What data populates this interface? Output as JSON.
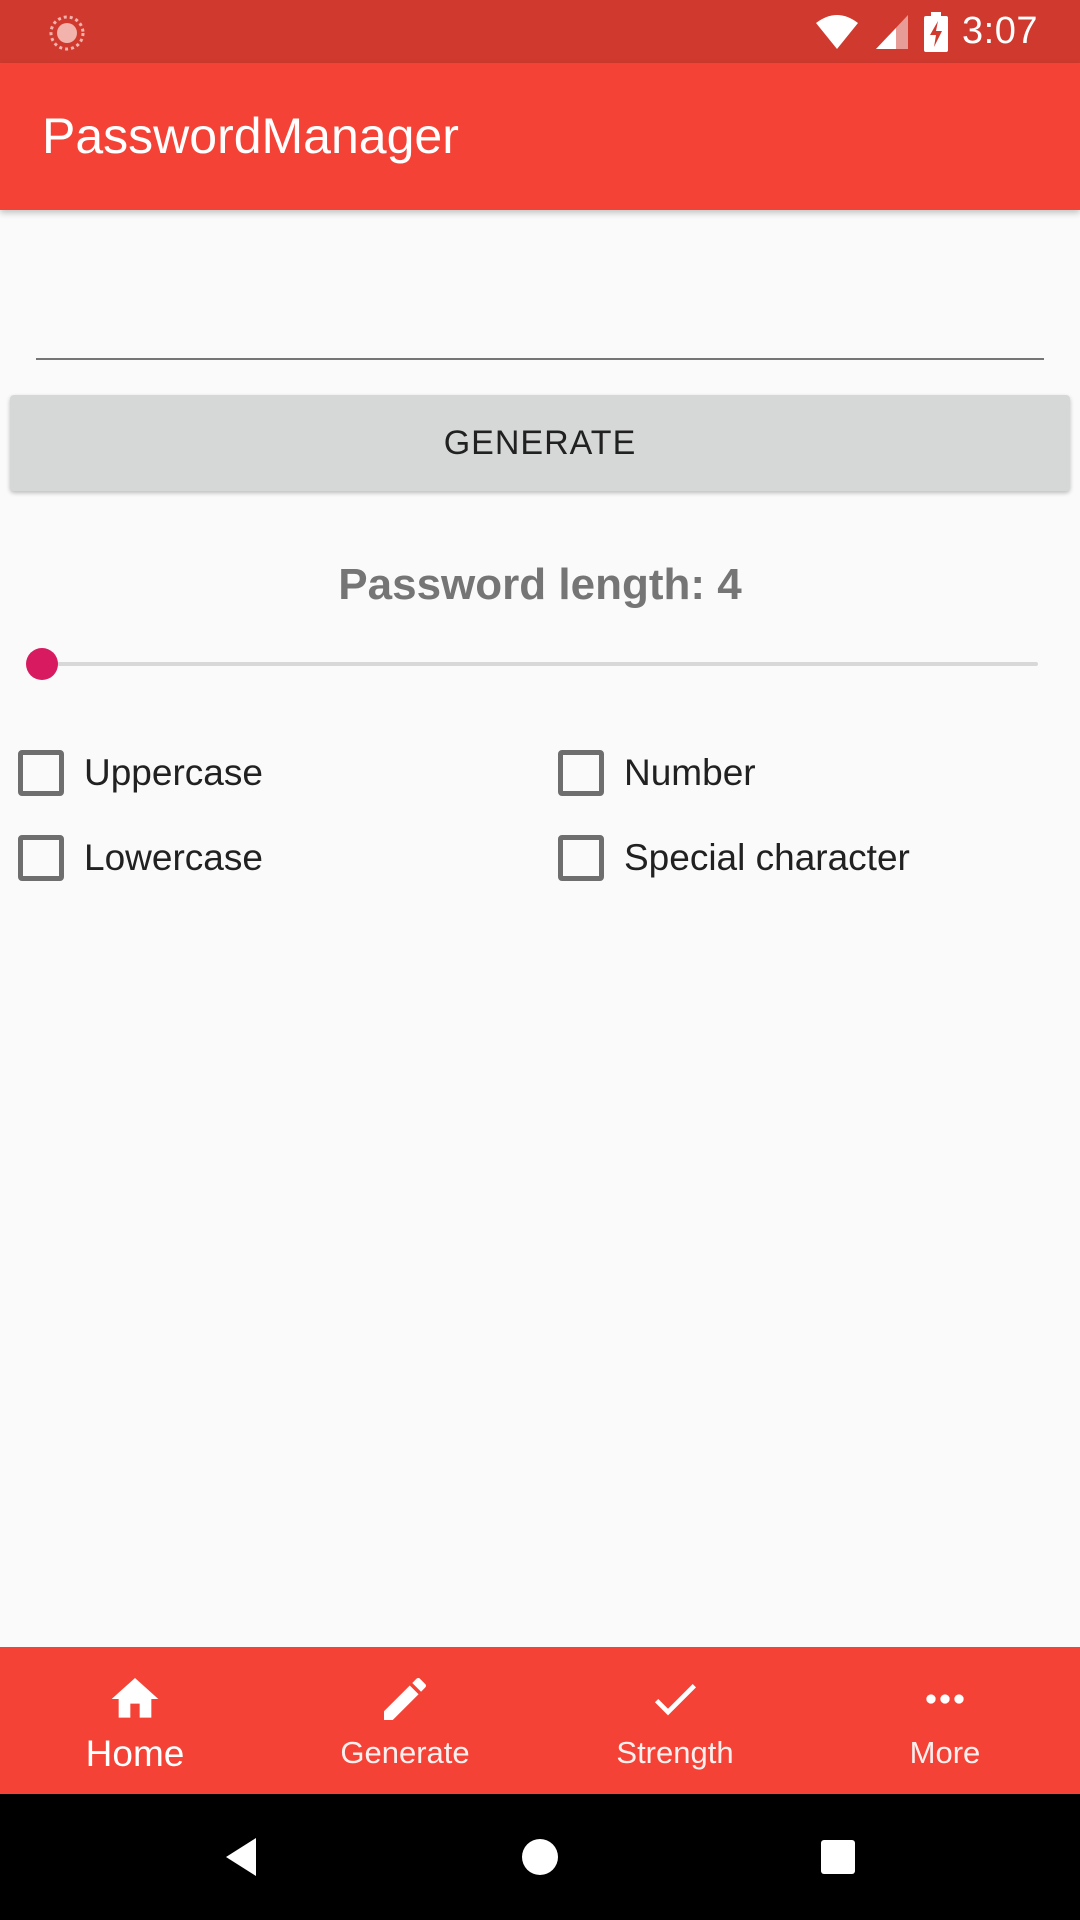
{
  "status_bar": {
    "time": "3:07",
    "icons": [
      "loading-indicator-icon",
      "wifi-icon",
      "cellular-signal-icon",
      "battery-charging-icon"
    ]
  },
  "app_bar": {
    "title": "PasswordManager"
  },
  "password_field": {
    "value": "",
    "placeholder": ""
  },
  "generate_button": {
    "label": "GENERATE"
  },
  "length": {
    "label": "Password length: 4",
    "value": 4,
    "slider_fraction": 0.0
  },
  "options": [
    {
      "label": "Uppercase",
      "checked": false
    },
    {
      "label": "Number",
      "checked": false
    },
    {
      "label": "Lowercase",
      "checked": false
    },
    {
      "label": "Special character",
      "checked": false
    }
  ],
  "bottom_nav": [
    {
      "label": "Home",
      "icon": "home-icon",
      "active": true
    },
    {
      "label": "Generate",
      "icon": "pencil-icon",
      "active": false
    },
    {
      "label": "Strength",
      "icon": "check-icon",
      "active": false
    },
    {
      "label": "More",
      "icon": "more-horizontal-icon",
      "active": false
    }
  ],
  "colors": {
    "primary": "#f44336",
    "primary_dark": "#d0392e",
    "accent": "#d81b60",
    "background": "#fafafa"
  },
  "system_nav": {
    "icons": [
      "back-icon",
      "home-circle-icon",
      "recents-icon"
    ]
  }
}
